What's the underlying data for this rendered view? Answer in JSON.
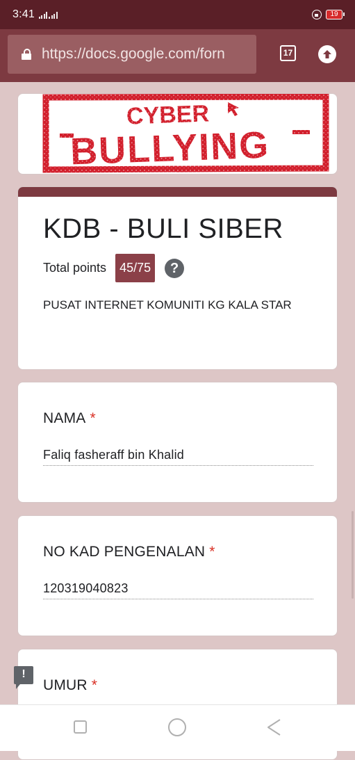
{
  "status_bar": {
    "time": "3:41",
    "network": "4G",
    "battery": "19"
  },
  "browser": {
    "url": "https://docs.google.com/forn",
    "tab_count": "17"
  },
  "banner": {
    "line1": "CYBER",
    "line2": "BULLYING"
  },
  "form": {
    "title": "KDB - BULI SIBER",
    "points_label": "Total points",
    "points_value": "45/75",
    "help_glyph": "?",
    "description": "PUSAT INTERNET KOMUNITI KG KALA STAR"
  },
  "questions": [
    {
      "title": "NAMA",
      "required_mark": "*",
      "answer": "Faliq fasheraff bin Khalid"
    },
    {
      "title": "NO KAD PENGENALAN",
      "required_mark": "*",
      "answer": "120319040823"
    },
    {
      "title": "UMUR",
      "required_mark": "*"
    }
  ],
  "feedback": {
    "glyph": "!"
  },
  "colors": {
    "theme": "#7d3a41",
    "page_background": "#ddc6c6",
    "status_bar": "#5a1f27",
    "badge": "#8b4048",
    "required": "#d93025",
    "banner_red": "#d21f2c"
  },
  "icons": {
    "url_lock": "lock-icon",
    "upload": "upload-arrow-icon",
    "help": "help-circle-icon",
    "feedback": "feedback-icon",
    "nav_recent": "square-icon",
    "nav_home": "circle-icon",
    "nav_back": "triangle-back-icon"
  }
}
